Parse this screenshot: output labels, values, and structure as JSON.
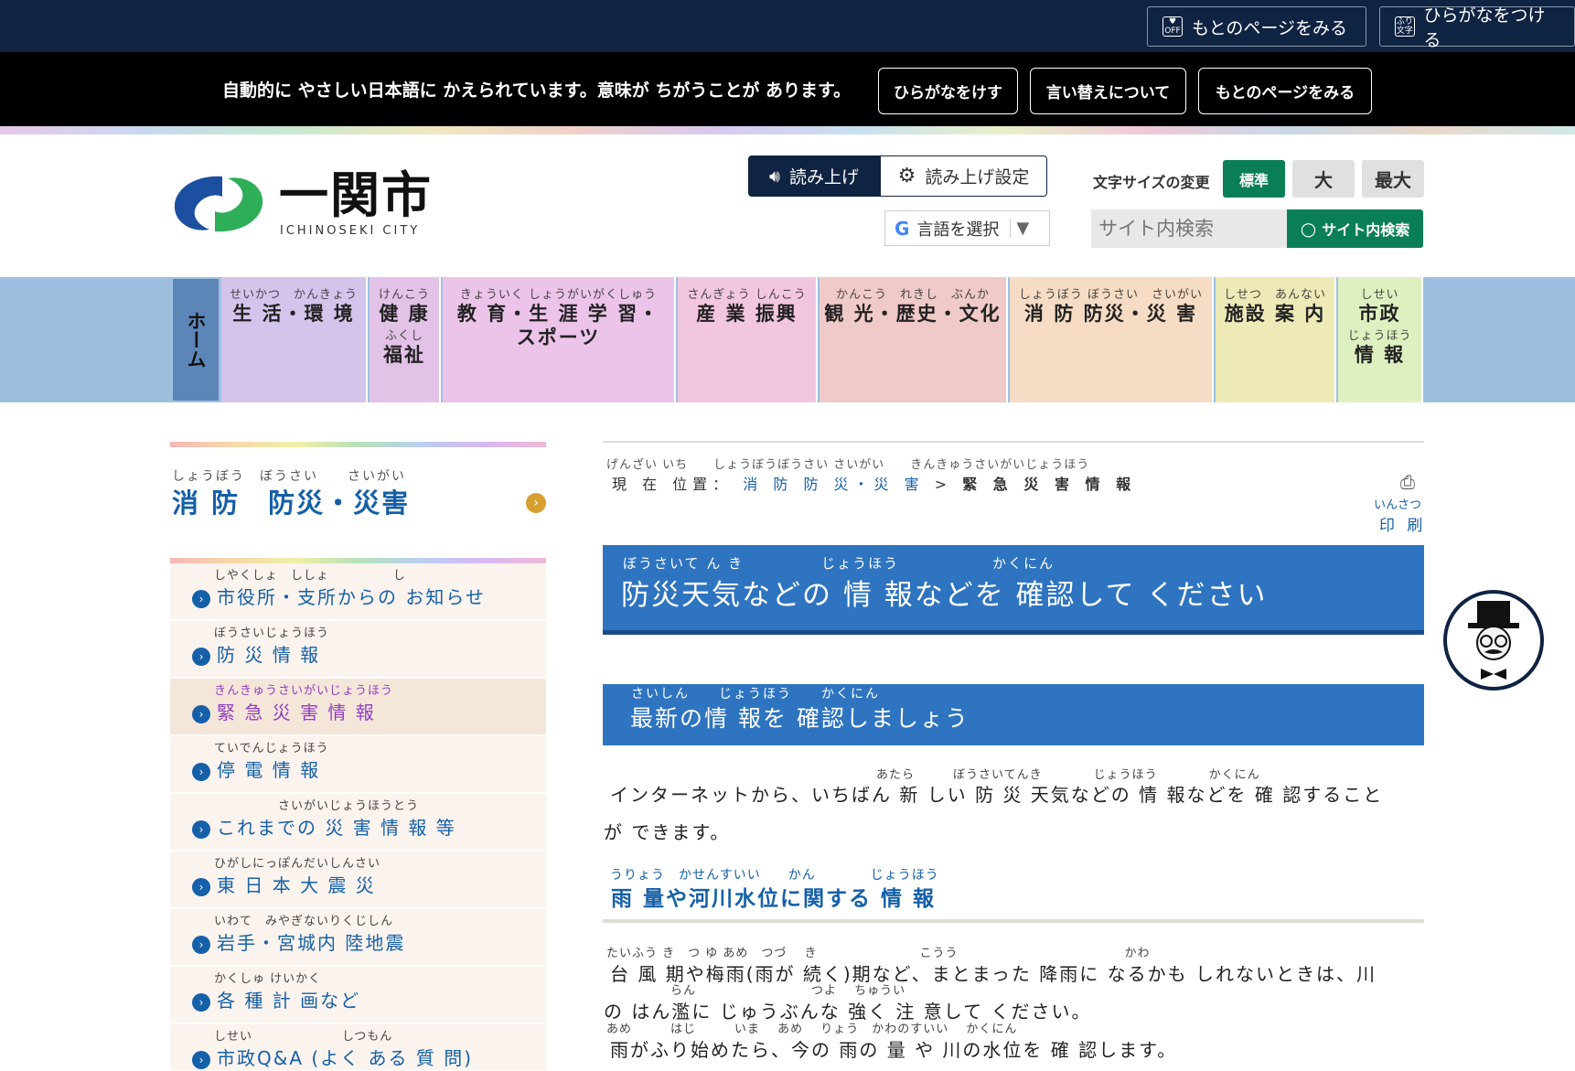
{
  "topbar": {
    "original_page": "もとのページをみる",
    "original_icon_text": "OFF",
    "hiragana_btn": "ひらがなをつける",
    "hiragana_icon_text": "ふり文字"
  },
  "notice": {
    "text": "自動的に やさしい日本語に かえられています。意味が ちがうことが あります。",
    "btn_remove_hiragana": "ひらがなをけす",
    "btn_about": "言い替えについて",
    "btn_original": "もとのページをみる"
  },
  "header": {
    "logo_text": "一関市",
    "logo_sub": "ICHINOSEKI CITY",
    "read_aloud": "読み上げ",
    "read_settings": "読み上げ設定",
    "language": "言語を選択",
    "font_size_label": "文字サイズの変更",
    "font_sizes": [
      "標準",
      "大",
      "最大"
    ],
    "search_placeholder": "サイト内検索",
    "search_button": "サイト内検索"
  },
  "nav": {
    "home": "ホーム",
    "items": [
      {
        "ruby": "せいかつ　かんきょう",
        "label": "生 活・環 境",
        "color": "#d4c4ec"
      },
      {
        "ruby": "けんこう",
        "label": "健 康",
        "ruby2": "ふくし",
        "label2": "福祉",
        "color": "#e3c2e8"
      },
      {
        "ruby": "きょういく しょうがいがくしゅう",
        "label": "教 育・生 涯 学 習・",
        "label2": "スポーツ",
        "color": "#ecc4ea"
      },
      {
        "ruby": "さんぎょう しんこう",
        "label": "産 業 振興",
        "color": "#f3c6e0"
      },
      {
        "ruby": "かんこう　れきし　ぶんか",
        "label": "観 光・歴史・文化",
        "color": "#f0cac8"
      },
      {
        "ruby": "しょうぼう ぼうさい　さいがい",
        "label": "消 防 防災・災 害",
        "color": "#f6dcc4"
      },
      {
        "ruby": "しせつ　あんない",
        "label": "施設 案 内",
        "color": "#eeeab8"
      },
      {
        "ruby": "しせい",
        "label": "市政",
        "ruby2": "じょうほう",
        "label2": "情 報",
        "color": "#dff0c0"
      }
    ]
  },
  "sidebar": {
    "ruby": "しょうぼう　ぼうさい　　さいがい",
    "title": "消 防　防災・災害",
    "items": [
      {
        "ruby": "しやくしょ　ししょ　　　　　し",
        "label": "市役所・支所からの お知らせ"
      },
      {
        "ruby": "ぼうさいじょうほう",
        "label": "防 災 情 報"
      },
      {
        "ruby": "きんきゅうさいがいじょうほう",
        "label": "緊 急 災 害 情 報"
      },
      {
        "ruby": "ていでんじょうほう",
        "label": "停 電 情 報"
      },
      {
        "ruby": "　　　　　さいがいじょうほうとう",
        "label": "これまでの 災 害 情 報 等"
      },
      {
        "ruby": "ひがしにっぽんだいしんさい",
        "label": "東 日 本 大 震 災"
      },
      {
        "ruby": "いわて　みやぎないりくじしん",
        "label": "岩手・宮城内 陸地震"
      },
      {
        "ruby": "かくしゅ けいかく",
        "label": "各 種 計 画など"
      },
      {
        "ruby": "しせい　　　　　　　しつもん",
        "label": "市政Q&A (よく ある 質 問)"
      }
    ]
  },
  "breadcrumb": {
    "ruby": "げんざい いち　　しょうぼうぼうさい さいがい　　きんきゅうさいがいじょうほう",
    "prefix": "現 在 位置：",
    "link": "消 防 防 災・災 害",
    "sep": ">",
    "current": "緊 急 災 害 情 報"
  },
  "print": {
    "ruby": "いんさつ",
    "label": "印 刷"
  },
  "main": {
    "h1_ruby": "ぼうさいて ん き　　　　　じょうほう　　　　　　かくにん",
    "h1": "防災天気などの 情 報などを 確認して ください",
    "h2_ruby": "さいしん　　じょうほう　　かくにん",
    "h2": "最新の情 報を 確認しましょう",
    "p1_ruby": "あたら　　　ぼうさいてんき　　　　じょうほう　　　　かくにん",
    "p1_line1": "インターネットから、いちばん 新 しい 防 災 天気などの 情 報などを 確 認すること",
    "p1_line2": "が できます。",
    "h3_ruby": "うりょう　かせんすいい　　かん　　　　じょうほう",
    "h3": "雨 量や河川水位に関する 情 報",
    "p2_ruby": "たいふう き　つ ゆ あめ　つづ　 き　　　　　　　　こうう　　　　　　　　　　　　　かわ",
    "p2_line1": "台 風 期や梅雨(雨が 続く)期など、まとまった 降雨に なるかも しれないときは、川",
    "p2_ruby2": "らん　　　　　　　　　つよ　 ちゅうい",
    "p2_line2": "の はん濫に じゅうぶんな 強く 注 意して ください。",
    "p3_ruby": "あめ　　　はじ　　　いま　 あめ　 りょう　かわのすいい　 かくにん",
    "p3_line1": "雨がふり始めたら、今の 雨の 量 や 川の水位を 確 認します。"
  },
  "colors": {
    "topbar": "#0f2342",
    "accent_blue": "#2e74c0",
    "link_blue": "#1560a8",
    "green": "#0a7f56",
    "active_purple": "#9040c0"
  }
}
